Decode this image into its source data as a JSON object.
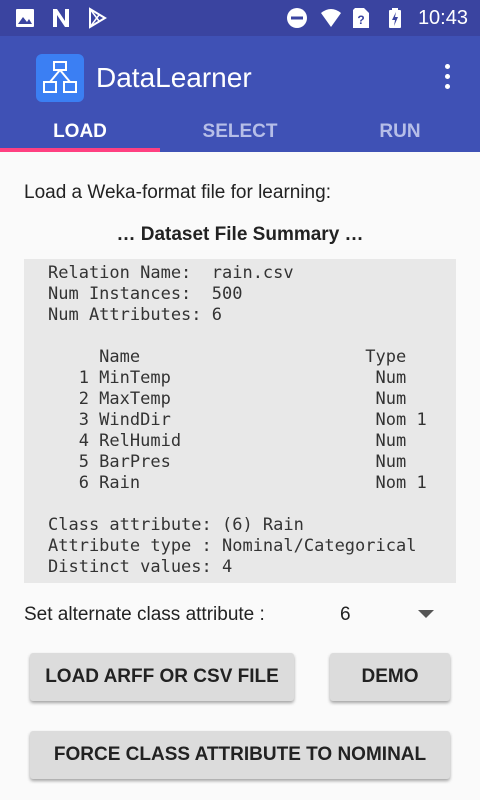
{
  "status_bar": {
    "time": "10:43",
    "icons": [
      "image-icon",
      "n-notification-icon",
      "play-store-icon",
      "do-not-disturb-icon",
      "wifi-icon",
      "no-sim-icon",
      "battery-charging-icon"
    ]
  },
  "app_bar": {
    "title": "DataLearner",
    "logo_icon": "diagram-icon",
    "overflow_icon": "more-vert-icon",
    "color": "#3f51b5"
  },
  "tabs": [
    {
      "label": "LOAD",
      "active": true
    },
    {
      "label": "SELECT",
      "active": false
    },
    {
      "label": "RUN",
      "active": false
    }
  ],
  "accent": "#ff4081",
  "main": {
    "intro": "Load a Weka-format file for learning:",
    "summary_title": "… Dataset File Summary …",
    "summary_lines": [
      "Relation Name:  rain.csv",
      "Num Instances:  500",
      "Num Attributes: 6",
      "",
      "     Name                      Type",
      "   1 MinTemp                    Num",
      "   2 MaxTemp                    Num",
      "   3 WindDir                    Nom 1",
      "   4 RelHumid                   Num",
      "   5 BarPres                    Num",
      "   6 Rain                       Nom 1",
      "",
      "Class attribute: (6) Rain",
      "Attribute type : Nominal/Categorical",
      "Distinct values: 4"
    ],
    "alt_class_label": "Set alternate class attribute :",
    "alt_class_value": "6"
  },
  "buttons": {
    "load": "LOAD ARFF OR CSV FILE",
    "demo": "DEMO",
    "force": "FORCE CLASS ATTRIBUTE TO NOMINAL"
  }
}
